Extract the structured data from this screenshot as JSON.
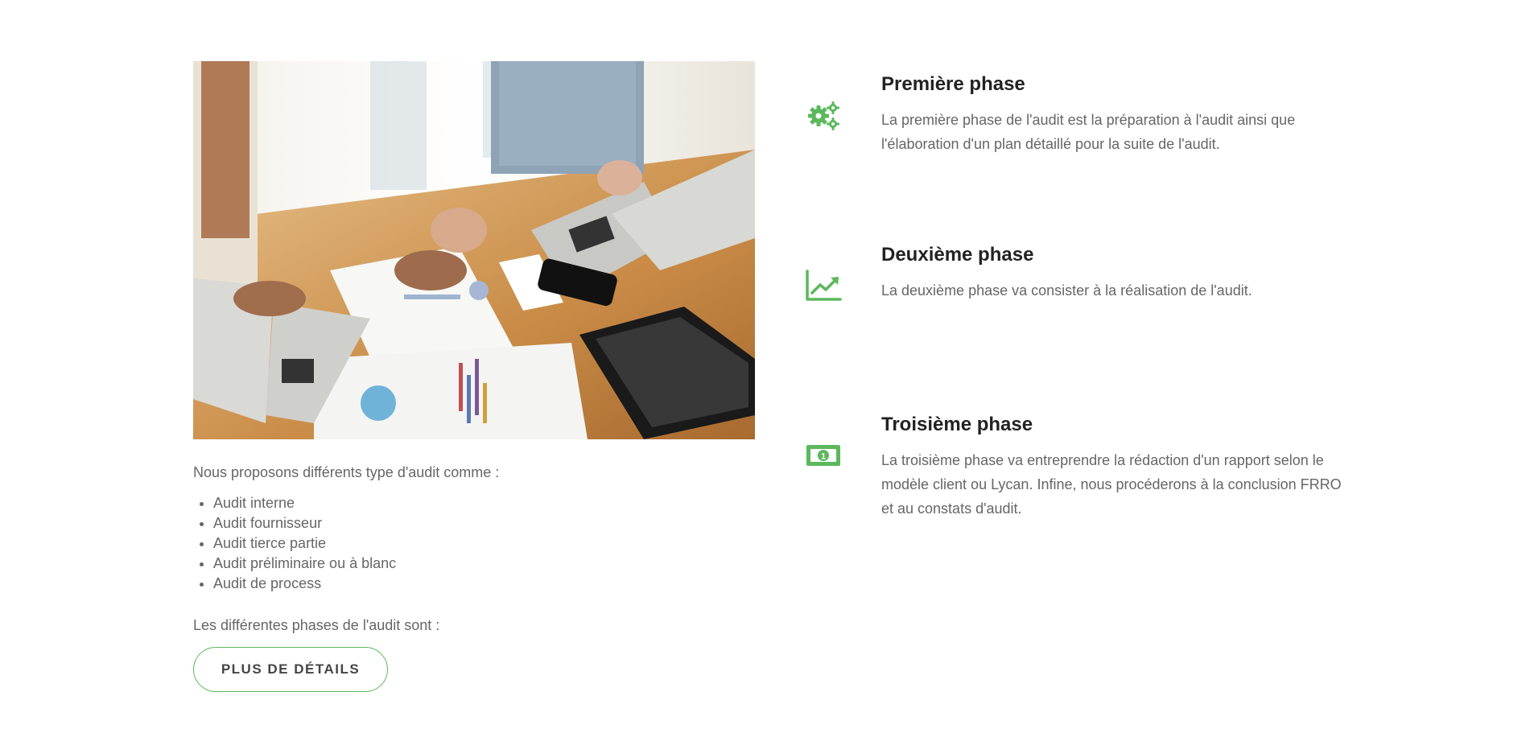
{
  "accent_color": "#5cb85c",
  "image": {
    "description_icon": "office-team-laptops-photo"
  },
  "intro": {
    "text": "Nous proposons différents type d'audit comme :"
  },
  "audit_types": [
    "Audit interne",
    "Audit fournisseur",
    "Audit tierce partie",
    "Audit préliminaire ou à blanc",
    "Audit de process"
  ],
  "phases_intro": "Les différentes phases de l'audit sont :",
  "details_button": "PLUS DE DÉTAILS",
  "phases": [
    {
      "icon": "gears-icon",
      "title": "Première phase",
      "description": "La première phase de l'audit est la préparation à l'audit ainsi que l'élaboration d'un plan détaillé pour la suite de l'audit."
    },
    {
      "icon": "line-chart-icon",
      "title": "Deuxième phase",
      "description": "La deuxième phase va consister à la réalisation de l'audit."
    },
    {
      "icon": "money-icon",
      "title": "Troisième phase",
      "description": "La troisième phase va entreprendre la rédaction d'un rapport selon le modèle client ou Lycan. Infine, nous procéderons à la conclusion FRRO et au constats d'audit."
    }
  ]
}
